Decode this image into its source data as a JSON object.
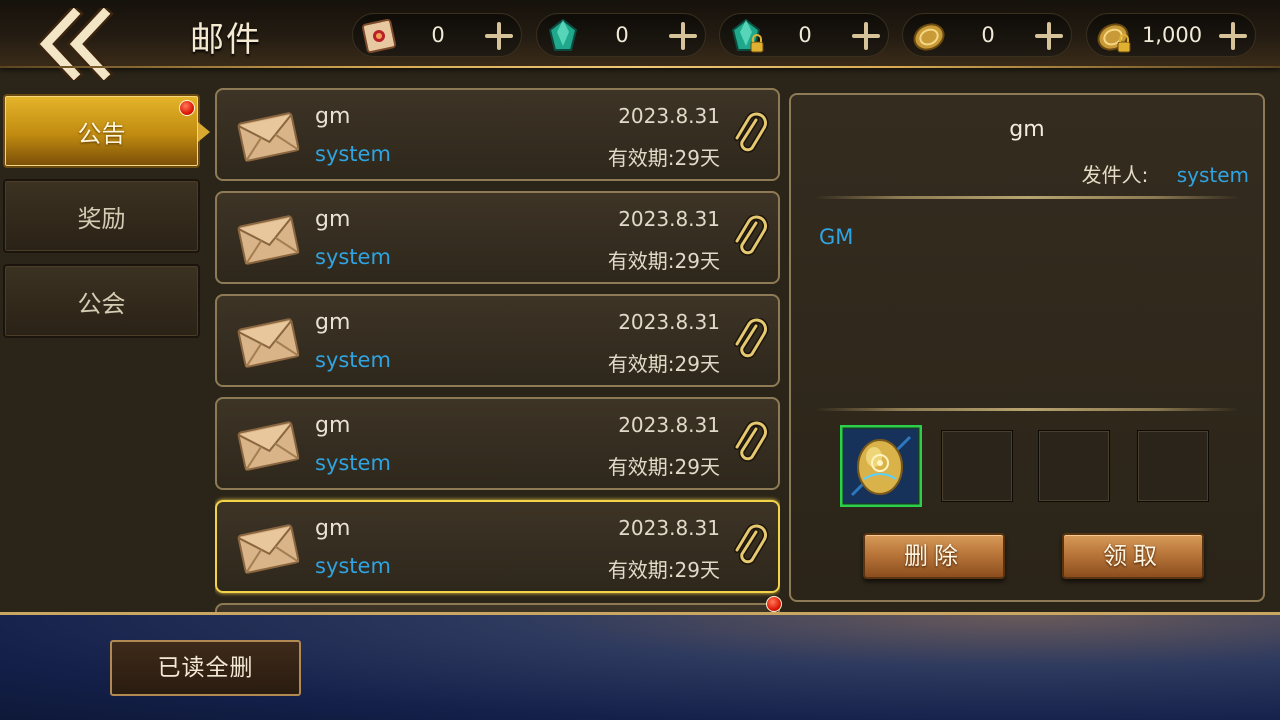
{
  "header": {
    "title": "邮件",
    "currencies": [
      {
        "icon": "scroll-icon",
        "value": "0"
      },
      {
        "icon": "gem-icon",
        "value": "0"
      },
      {
        "icon": "locked-gem-icon",
        "value": "0"
      },
      {
        "icon": "coin-icon",
        "value": "0"
      },
      {
        "icon": "locked-coin-icon",
        "value": "1,000"
      }
    ]
  },
  "tabs": [
    {
      "label": "公告",
      "active": true,
      "badge": true
    },
    {
      "label": "奖励",
      "active": false,
      "badge": false
    },
    {
      "label": "公会",
      "active": false,
      "badge": false
    }
  ],
  "mails": [
    {
      "title": "gm",
      "sender": "system",
      "date": "2023.8.31",
      "expire": "有效期:29天",
      "selected": false
    },
    {
      "title": "gm",
      "sender": "system",
      "date": "2023.8.31",
      "expire": "有效期:29天",
      "selected": false
    },
    {
      "title": "gm",
      "sender": "system",
      "date": "2023.8.31",
      "expire": "有效期:29天",
      "selected": false
    },
    {
      "title": "gm",
      "sender": "system",
      "date": "2023.8.31",
      "expire": "有效期:29天",
      "selected": false
    },
    {
      "title": "gm",
      "sender": "system",
      "date": "2023.8.31",
      "expire": "有效期:29天",
      "selected": true
    }
  ],
  "detail": {
    "title": "gm",
    "sender_label": "发件人:",
    "sender": "system",
    "body": "GM",
    "delete_label": "删除",
    "claim_label": "领取"
  },
  "footer": {
    "read_delete_label": "已读全删"
  },
  "colors": {
    "accent_gold": "#f2d34a",
    "link_blue": "#2fa4e0",
    "badge_red": "#e01a08"
  }
}
